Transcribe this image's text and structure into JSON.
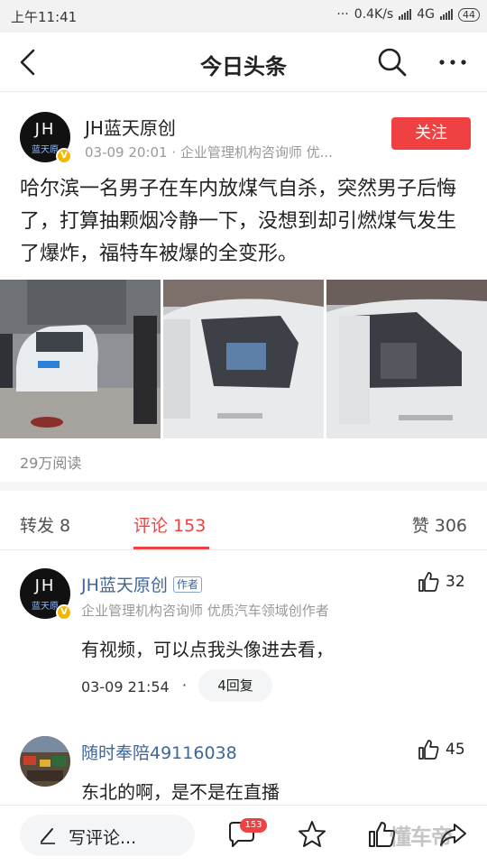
{
  "status_bar": {
    "time": "上午11:41",
    "dots": "···",
    "net_speed": "0.4K/s",
    "network": "4G",
    "battery": "44"
  },
  "nav": {
    "title": "今日头条",
    "icons": [
      "back-arrow-icon",
      "search-icon",
      "more-icon"
    ]
  },
  "author": {
    "avatar_text": "JH",
    "avatar_sub": "蓝天原",
    "badge": "V",
    "name": "JH蓝天原创",
    "meta": "03-09 20:01 · 企业管理机构咨询师 优...",
    "follow_label": "关注"
  },
  "post": {
    "text": "哈尔滨一名男子在车内放煤气自杀，突然男子后悔了，打算抽颗烟冷静一下，没想到却引燃煤气发生了爆炸，福特车被爆的全变形。",
    "read_count": "29万阅读"
  },
  "tabs": {
    "forward": "转发 8",
    "comment": "评论 153",
    "like": "赞 306"
  },
  "comments": [
    {
      "avatar_text": "JH",
      "avatar_sub": "蓝天原",
      "badge": "V",
      "name": "JH蓝天原创",
      "author_tag": "作者",
      "subtitle": "企业管理机构咨询师 优质汽车领域创作者",
      "text": "有视频，可以点我头像进去看，",
      "time": "03-09 21:54",
      "dot": "·",
      "replies": "4回复",
      "likes": "32"
    },
    {
      "name": "随时奉陪49116038",
      "text": "东北的啊，是不是在直播",
      "likes": "45"
    }
  ],
  "bottom_bar": {
    "write_placeholder": "写评论...",
    "comment_badge": "153",
    "watermark": "懂车帝"
  },
  "colors": {
    "accent_red": "#f04142",
    "link_blue": "#406599",
    "badge_yellow": "#f5b800"
  }
}
